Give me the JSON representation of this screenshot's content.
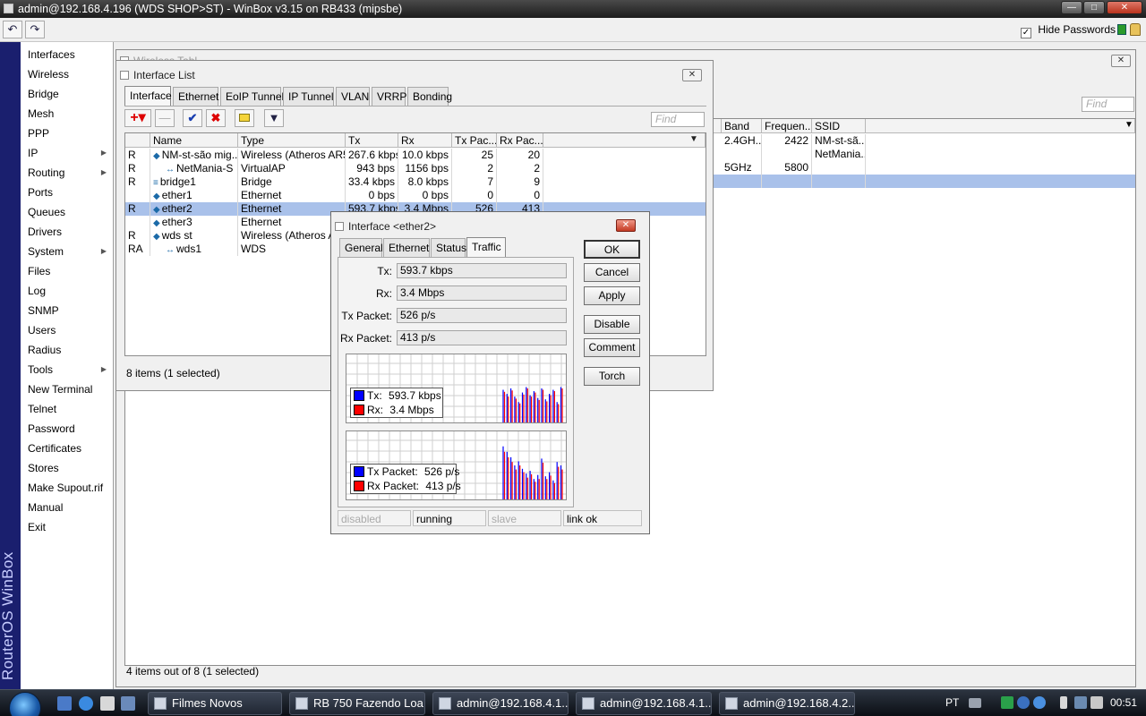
{
  "app": {
    "title": "admin@192.168.4.196 (WDS SHOP>ST) - WinBox v3.15 on RB433 (mipsbe)",
    "sidebar_brand": "RouterOS WinBox"
  },
  "toolbar": {
    "undo_label": "↶",
    "redo_label": "↷",
    "hide_passwords_label": "Hide Passwords",
    "hide_passwords_checked": true
  },
  "menu": {
    "items": [
      {
        "label": "Interfaces",
        "submenu": false
      },
      {
        "label": "Wireless",
        "submenu": false
      },
      {
        "label": "Bridge",
        "submenu": false
      },
      {
        "label": "Mesh",
        "submenu": false
      },
      {
        "label": "PPP",
        "submenu": false
      },
      {
        "label": "IP",
        "submenu": true
      },
      {
        "label": "Routing",
        "submenu": true
      },
      {
        "label": "Ports",
        "submenu": false
      },
      {
        "label": "Queues",
        "submenu": false
      },
      {
        "label": "Drivers",
        "submenu": false
      },
      {
        "label": "System",
        "submenu": true
      },
      {
        "label": "Files",
        "submenu": false
      },
      {
        "label": "Log",
        "submenu": false
      },
      {
        "label": "SNMP",
        "submenu": false
      },
      {
        "label": "Users",
        "submenu": false
      },
      {
        "label": "Radius",
        "submenu": false
      },
      {
        "label": "Tools",
        "submenu": true
      },
      {
        "label": "New Terminal",
        "submenu": false
      },
      {
        "label": "Telnet",
        "submenu": false
      },
      {
        "label": "Password",
        "submenu": false
      },
      {
        "label": "Certificates",
        "submenu": false
      },
      {
        "label": "Stores",
        "submenu": false
      },
      {
        "label": "Make Supout.rif",
        "submenu": false
      },
      {
        "label": "Manual",
        "submenu": false
      },
      {
        "label": "Exit",
        "submenu": false
      }
    ]
  },
  "wireless_tables": {
    "title_partial": "Wireless Tabl",
    "find_placeholder": "Find",
    "columns": [
      "Band",
      "Frequen...",
      "SSID"
    ],
    "rows": [
      [
        "2.4GH...",
        "2422",
        "NM-st-sã..."
      ],
      [
        "",
        "",
        "NetMania..."
      ],
      [
        "5GHz",
        "5800",
        ""
      ],
      [
        "",
        "",
        ""
      ]
    ],
    "status": "4 items out of 8 (1 selected)"
  },
  "interface_list": {
    "title": "Interface List",
    "tabs": [
      "Interface",
      "Ethernet",
      "EoIP Tunnel",
      "IP Tunnel",
      "VLAN",
      "VRRP",
      "Bonding"
    ],
    "find_placeholder": "Find",
    "columns": [
      "",
      "Name",
      "Type",
      "Tx",
      "Rx",
      "Tx Pac...",
      "Rx Pac..."
    ],
    "rows": [
      {
        "flag": "R",
        "icon": "wireless-icon",
        "name": "NM-st-são mig...",
        "type": "Wireless (Atheros AR5...",
        "tx": "267.6 kbps",
        "rx": "10.0 kbps",
        "txp": "25",
        "rxp": "20",
        "indent": 0,
        "selected": false
      },
      {
        "flag": "R",
        "icon": "virtual-ap-icon",
        "name": "NetMania-S",
        "type": "VirtualAP",
        "tx": "943 bps",
        "rx": "1156 bps",
        "txp": "2",
        "rxp": "2",
        "indent": 1,
        "selected": false
      },
      {
        "flag": "R",
        "icon": "bridge-icon",
        "name": "bridge1",
        "type": "Bridge",
        "tx": "33.4 kbps",
        "rx": "8.0 kbps",
        "txp": "7",
        "rxp": "9",
        "indent": 0,
        "selected": false
      },
      {
        "flag": "",
        "icon": "ethernet-icon",
        "name": "ether1",
        "type": "Ethernet",
        "tx": "0 bps",
        "rx": "0 bps",
        "txp": "0",
        "rxp": "0",
        "indent": 0,
        "selected": false
      },
      {
        "flag": "R",
        "icon": "ethernet-icon",
        "name": "ether2",
        "type": "Ethernet",
        "tx": "593.7 kbps",
        "rx": "3.4 Mbps",
        "txp": "526",
        "rxp": "413",
        "indent": 0,
        "selected": true
      },
      {
        "flag": "",
        "icon": "ethernet-icon",
        "name": "ether3",
        "type": "Ethernet",
        "tx": "",
        "rx": "",
        "txp": "",
        "rxp": "",
        "indent": 0,
        "selected": false
      },
      {
        "flag": "R",
        "icon": "wireless-icon",
        "name": "wds st",
        "type": "Wireless (Atheros AR",
        "tx": "",
        "rx": "",
        "txp": "",
        "rxp": "",
        "indent": 0,
        "selected": false
      },
      {
        "flag": "RA",
        "icon": "wds-icon",
        "name": "wds1",
        "type": "WDS",
        "tx": "",
        "rx": "",
        "txp": "",
        "rxp": "",
        "indent": 1,
        "selected": false
      }
    ],
    "status": "8 items (1 selected)"
  },
  "iface_dialog": {
    "title": "Interface <ether2>",
    "tabs": [
      "General",
      "Ethernet",
      "Status",
      "Traffic"
    ],
    "active_tab": "Traffic",
    "fields": [
      {
        "label": "Tx:",
        "value": "593.7 kbps"
      },
      {
        "label": "Rx:",
        "value": "3.4 Mbps"
      },
      {
        "label": "Tx Packet:",
        "value": "526 p/s"
      },
      {
        "label": "Rx Packet:",
        "value": "413 p/s"
      }
    ],
    "buttons": [
      "OK",
      "Cancel",
      "Apply",
      "Disable",
      "Comment",
      "Torch"
    ],
    "traffic_legend": [
      {
        "label": "Tx:",
        "value": "593.7 kbps",
        "color": "#0000ff"
      },
      {
        "label": "Rx:",
        "value": "3.4 Mbps",
        "color": "#ff0000"
      }
    ],
    "packet_legend": [
      {
        "label": "Tx Packet:",
        "value": "526 p/s",
        "color": "#0000ff"
      },
      {
        "label": "Rx Packet:",
        "value": "413 p/s",
        "color": "#ff0000"
      }
    ],
    "status_fields": [
      "disabled",
      "running",
      "slave",
      "link ok"
    ]
  },
  "chart_data": [
    {
      "type": "bar",
      "series": [
        {
          "values": [
            0.48,
            0.42,
            0.5,
            0.38,
            0.3,
            0.44,
            0.52,
            0.4,
            0.46,
            0.36,
            0.5,
            0.34,
            0.42,
            0.48,
            0.3,
            0.52
          ]
        },
        {
          "values": [
            0.45,
            0.38,
            0.47,
            0.35,
            0.28,
            0.41,
            0.5,
            0.38,
            0.44,
            0.33,
            0.48,
            0.31,
            0.4,
            0.46,
            0.27,
            0.5
          ]
        }
      ]
    },
    {
      "type": "bar",
      "series": [
        {
          "values": [
            0.78,
            0.7,
            0.62,
            0.5,
            0.56,
            0.45,
            0.38,
            0.42,
            0.3,
            0.36,
            0.6,
            0.34,
            0.4,
            0.28,
            0.55,
            0.5
          ]
        },
        {
          "values": [
            0.7,
            0.62,
            0.55,
            0.44,
            0.5,
            0.4,
            0.32,
            0.37,
            0.26,
            0.3,
            0.54,
            0.3,
            0.35,
            0.24,
            0.48,
            0.44
          ]
        }
      ]
    }
  ],
  "taskbar": {
    "items": [
      "Filmes Novos",
      "RB 750 Fazendo Loa...",
      "admin@192.168.4.1...",
      "admin@192.168.4.1...",
      "admin@192.168.4.2..."
    ],
    "lang": "PT",
    "clock": "00:51"
  },
  "colors": {
    "selection": "#a9c1ea",
    "sidebar": "#1a1f6e",
    "tx": "#0000ff",
    "rx": "#ff0000"
  }
}
